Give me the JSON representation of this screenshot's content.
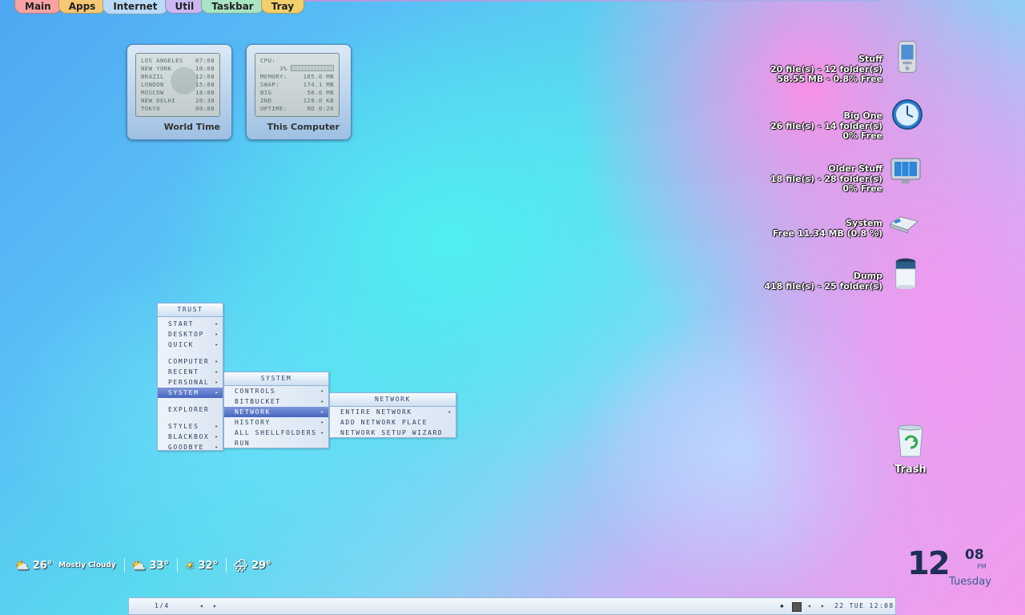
{
  "top_tabs": [
    {
      "label": "Main",
      "color": "#f7a3a3"
    },
    {
      "label": "Apps",
      "color": "#f6c774"
    },
    {
      "label": "Internet",
      "color": "#b9dbf7"
    },
    {
      "label": "Util",
      "color": "#c9b8f2"
    },
    {
      "label": "Taskbar",
      "color": "#a9e5c3"
    },
    {
      "label": "Tray",
      "color": "#f3cf6b"
    }
  ],
  "world_time": {
    "label": "World Time",
    "rows": [
      {
        "city": "LOS ANGELES",
        "time": "07:08"
      },
      {
        "city": "NEW YORK",
        "time": "10:08"
      },
      {
        "city": "BRAZIL",
        "time": "12:08"
      },
      {
        "city": "LONDON",
        "time": "15:08"
      },
      {
        "city": "MOSCOW",
        "time": "18:08"
      },
      {
        "city": "NEW DELHI",
        "time": "20:38"
      },
      {
        "city": "TOKYO",
        "time": "00:08"
      }
    ]
  },
  "this_computer": {
    "label": "This Computer",
    "cpu_label": "CPU:",
    "cpu_value": "3%",
    "rows": [
      {
        "k": "MEMORY:",
        "v": "105.6 MB"
      },
      {
        "k": "SWAP:",
        "v": "174.1 MB"
      },
      {
        "k": "BIG",
        "v": "58.6 MB"
      },
      {
        "k": "2ND",
        "v": "120.0 KB"
      },
      {
        "k": "UPTIME:",
        "v": "0D 0:26"
      }
    ]
  },
  "drives": [
    {
      "name": "Stuff",
      "line1": "20 file(s) - 12 folder(s)",
      "line2": "58.55 MB - 0.8% Free",
      "icon": "pda-icon"
    },
    {
      "name": "Big One",
      "line1": "26 file(s) - 14 folder(s)",
      "line2": "0% Free",
      "icon": "clock-icon"
    },
    {
      "name": "Older Stuff",
      "line1": "18 file(s) - 28 folder(s)",
      "line2": "0% Free",
      "icon": "monitor-icon"
    },
    {
      "name": "System",
      "line1": "Free 11.34 MB (0.8 %)",
      "line2": "",
      "icon": "usb-drive-icon"
    },
    {
      "name": "Dump",
      "line1": "418 file(s) - 25 folder(s)",
      "line2": "",
      "icon": "bin-icon"
    }
  ],
  "trash": {
    "label": "Trash"
  },
  "menu_main": {
    "title": "TRUST",
    "items": [
      "START",
      "DESKTOP",
      "QUICK",
      "",
      "COMPUTER",
      "RECENT",
      "PERSONAL",
      "SYSTEM",
      "",
      "EXPLORER",
      "",
      "STYLES",
      "BLACKBOX",
      "GOODBYE"
    ]
  },
  "menu_system": {
    "title": "SYSTEM",
    "items": [
      "CONTROLS",
      "BITBUCKET",
      "NETWORK",
      "HISTORY",
      "ALL SHELLFOLDERS",
      "RUN"
    ]
  },
  "menu_network": {
    "title": "NETWORK",
    "items": [
      "ENTIRE NETWORK",
      "ADD NETWORK PLACE",
      "NETWORK SETUP WIZARD"
    ]
  },
  "weather": {
    "current": {
      "temp": "26°",
      "desc": "Mostly Cloudy"
    },
    "forecast": [
      {
        "temp": "33°"
      },
      {
        "temp": "32°"
      },
      {
        "temp": "29°"
      }
    ]
  },
  "clock": {
    "hour": "12",
    "minute": "08",
    "ampm": "PM",
    "day": "Tuesday"
  },
  "bottombar": {
    "workspace": "1/4",
    "prev": "◂",
    "next": "▸",
    "datetime": "22 TUE 12:08"
  }
}
